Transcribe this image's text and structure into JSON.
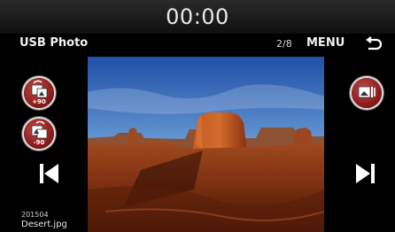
{
  "status_bar": {
    "clock": "00:00"
  },
  "header": {
    "title": "USB Photo",
    "counter": "2/8",
    "menu_label": "MENU",
    "back_icon": "back-arrow-icon"
  },
  "left_controls": {
    "rotate_cw_label": "+90",
    "rotate_ccw_label": "-90",
    "prev_icon": "skip-previous-icon"
  },
  "right_controls": {
    "slideshow_icon": "slideshow-icon",
    "next_icon": "skip-next-icon"
  },
  "file_info": {
    "date": "201504",
    "name": "Desert.jpg"
  },
  "colors": {
    "button_red": "#8d1d1d",
    "background": "#000000"
  }
}
